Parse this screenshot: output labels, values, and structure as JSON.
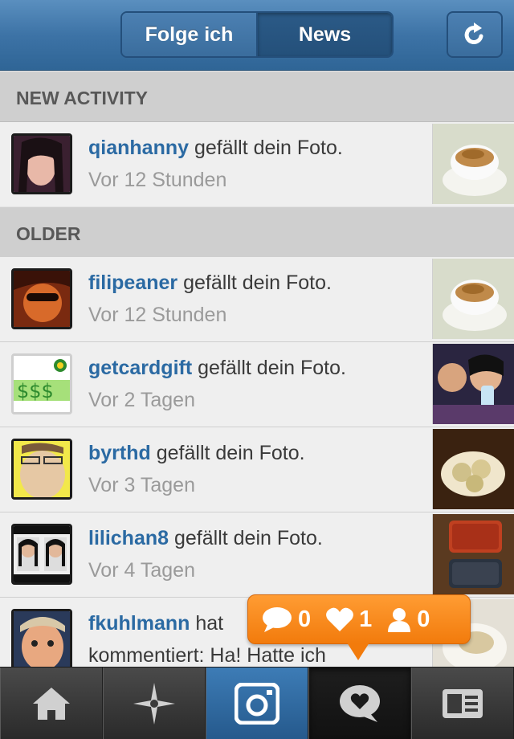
{
  "header": {
    "tab_following": "Folge ich",
    "tab_news": "News",
    "refresh_icon": "refresh-icon"
  },
  "sections": {
    "new_activity": "NEW ACTIVITY",
    "older": "OLDER"
  },
  "rows": [
    {
      "user": "qianhanny",
      "action": " gefällt dein Foto.",
      "time": "Vor 12 Stunden"
    },
    {
      "user": "filipeaner",
      "action": " gefällt dein Foto.",
      "time": "Vor 12 Stunden"
    },
    {
      "user": "getcardgift",
      "action": " gefällt dein Foto.",
      "time": "Vor 2 Tagen"
    },
    {
      "user": "byrthd",
      "action": " gefällt dein Foto.",
      "time": "Vor 3 Tagen"
    },
    {
      "user": "lilichan8",
      "action": " gefällt dein Foto.",
      "time": "Vor 4 Tagen"
    },
    {
      "user": "fkuhlmann",
      "action": " hat",
      "time": "kommentiert: Ha! Hatte ich"
    }
  ],
  "notifications": {
    "comments": "0",
    "likes": "1",
    "followers": "0"
  },
  "tabbar": {
    "icons": [
      "home-icon",
      "explore-icon",
      "camera-icon",
      "news-icon",
      "profile-icon"
    ]
  },
  "colors": {
    "header_blue": "#3d73a6",
    "username_blue": "#2b6aa3",
    "bubble_orange": "#f27b0c"
  }
}
